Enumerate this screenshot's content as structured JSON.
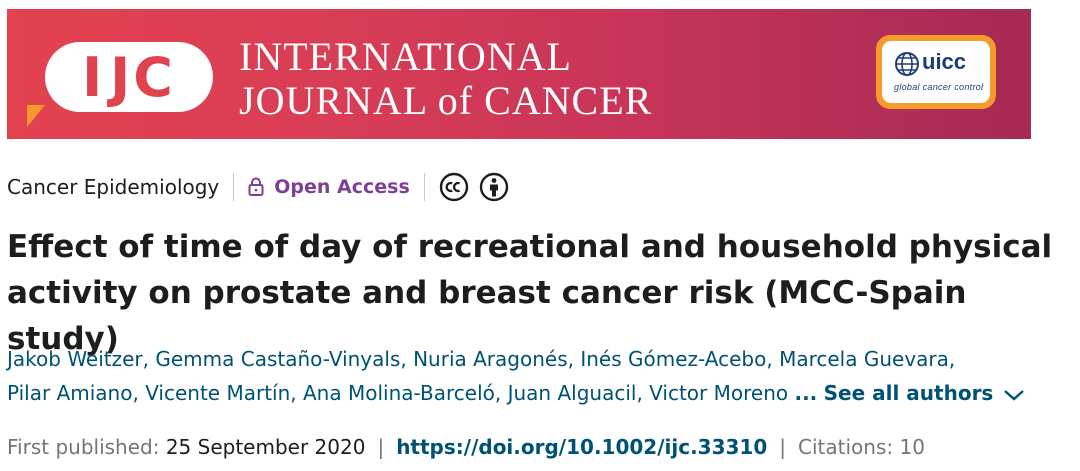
{
  "banner": {
    "logo_i": "I",
    "logo_jc": "JC",
    "journal_line1": "INTERNATIONAL",
    "journal_line2": "JOURNAL of CANCER",
    "partner_name": "uicc",
    "partner_tagline": "global cancer control",
    "colors": {
      "banner_start": "#e3424f",
      "banner_end": "#a52a55",
      "uicc_orange": "#f59a2b"
    }
  },
  "meta": {
    "section": "Cancer Epidemiology",
    "access": "Open Access",
    "icons": [
      "lock-icon",
      "creative-commons-icon",
      "attribution-icon"
    ]
  },
  "article": {
    "title": "Effect of time of day of recreational and household physical activity on prostate and breast cancer risk (MCC-Spain study)"
  },
  "authors": {
    "list": [
      "Jakob Weitzer",
      "Gemma Castaño-Vinyals",
      "Nuria Aragonés",
      "Inés Gómez-Acebo",
      "Marcela Guevara",
      "Pilar Amiano",
      "Vicente Martín",
      "Ana Molina-Barceló",
      "Juan Alguacil",
      "Victor Moreno"
    ],
    "ellipsis": "...",
    "see_all": "See all authors"
  },
  "publication": {
    "first_published_label": "First published:",
    "first_published_date": "25 September 2020",
    "doi": "https://doi.org/10.1002/ijc.33310",
    "citations_label": "Citations:",
    "citations_count": "10"
  }
}
